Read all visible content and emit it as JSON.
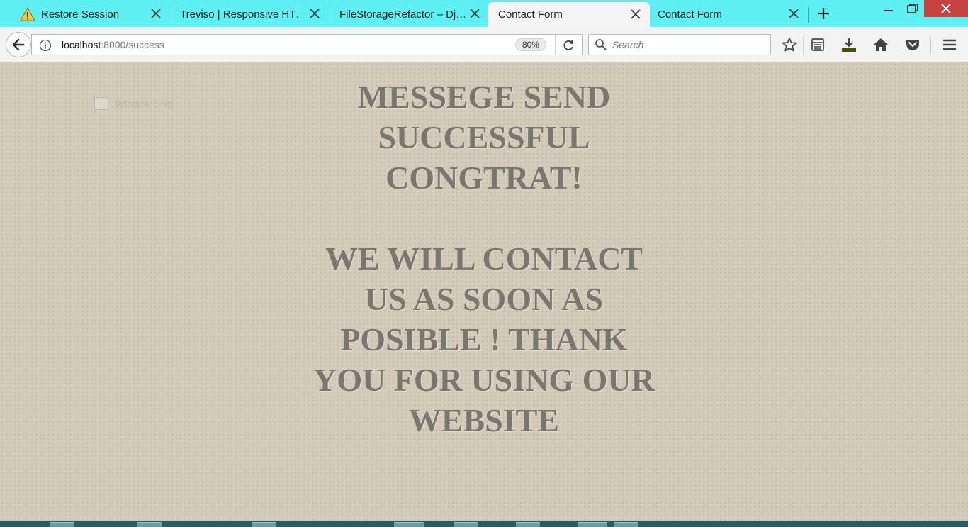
{
  "browser": {
    "tabs": [
      {
        "label": "Restore Session",
        "icon": "warning-icon",
        "active": false
      },
      {
        "label": "Treviso | Responsive HT…",
        "active": false
      },
      {
        "label": "FileStorageRefactor – Dj…",
        "active": false
      },
      {
        "label": "Contact Form",
        "active": true
      },
      {
        "label": "Contact Form",
        "active": false
      }
    ],
    "url_host": "localhost",
    "url_path": ":8000/success",
    "zoom": "80%",
    "search_placeholder": "Search",
    "accent_color": "#5ff0f5"
  },
  "page": {
    "background_color": "#d4cbbb",
    "text_color": "#7a7770",
    "ghost_label": "Window Snip",
    "message_lines_1": [
      "MESSEGE SEND",
      "SUCCESSFUL",
      "CONGTRAT!"
    ],
    "message_lines_2": [
      "WE WILL CONTACT",
      "US AS SOON AS",
      "POSIBLE ! THANK",
      "YOU FOR USING OUR",
      "WEBSITE"
    ]
  }
}
